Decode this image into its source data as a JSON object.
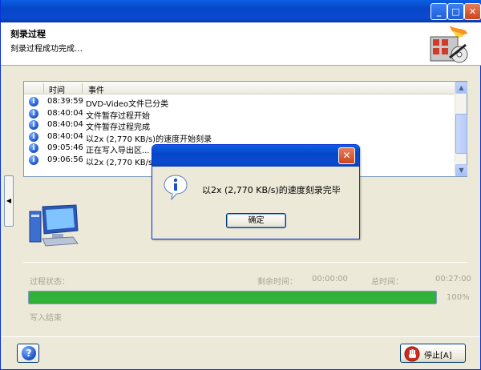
{
  "window": {
    "minimize_glyph": "_",
    "maximize_glyph": "□",
    "close_glyph": "✕"
  },
  "header": {
    "title": "刻录过程",
    "subtitle": "刻录过程成功完成…",
    "logo_icon": "flaming-disc-logo-icon"
  },
  "log": {
    "columns": {
      "time": "时间",
      "event": "事件"
    },
    "rows": [
      {
        "icon": "info-icon",
        "time": "08:39:59",
        "event": "DVD-Video文件已分类"
      },
      {
        "icon": "info-icon",
        "time": "08:40:04",
        "event": "文件暂存过程开始"
      },
      {
        "icon": "info-icon",
        "time": "08:40:04",
        "event": "文件暂存过程完成"
      },
      {
        "icon": "info-icon",
        "time": "08:40:04",
        "event": "以2x (2,770 KB/s)的速度开始刻录"
      },
      {
        "icon": "info-icon",
        "time": "09:05:46",
        "event": "正在写入导出区..."
      },
      {
        "icon": "info-icon",
        "time": "09:06:56",
        "event": "以2x (2,770 KB/s)的"
      }
    ]
  },
  "dialog": {
    "message": "以2x (2,770 KB/s)的速度刻录完毕",
    "ok_label": "确定",
    "close_glyph": "✕"
  },
  "status": {
    "process_label": "过程状态：",
    "remaining_label": "剩余时间：",
    "remaining_value": "00:00:00",
    "total_label": "总时间：",
    "total_value": "00:27:00",
    "progress_text": "100%",
    "progress_fraction": 1.0,
    "write_status": "写入结束"
  },
  "footer": {
    "help_glyph": "?",
    "stop_label": "停止[A]"
  },
  "colors": {
    "titlebar_blue": "#0a5fe0",
    "progress_green": "#2fb13a",
    "disabled_text": "#a7a491"
  }
}
